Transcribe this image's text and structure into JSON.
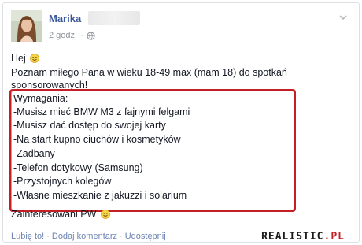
{
  "post": {
    "author": "Marika",
    "time": "2 godz.",
    "privacy_icon": "globe-icon",
    "menu_icon": "chevron-down-icon",
    "greeting": "Hej",
    "greeting_emoji": "smile-icon",
    "intro_line1": "Poznam miłego Pana w wieku 18-49 max (mam 18) do spotkań",
    "intro_line2": "sponsorowanych!",
    "requirements": [
      "Wymagania:",
      "-Musisz mieć BMW M3 z fajnymi felgami",
      "-Musisz dać dostęp do swojej karty",
      "-Na start kupno ciuchów i kosmetyków",
      "-Zadbany",
      "-Telefon dotykowy (Samsung)",
      "-Przystojnych kolegów",
      "-Własne mieszkanie z jakuzzi i solarium"
    ],
    "closing": "Zainteresowani PW",
    "closing_emoji": "smile-icon"
  },
  "actions": {
    "like": "Lubię to!",
    "comment": "Dodaj komentarz",
    "share": "Udostępnij",
    "separator": "·"
  },
  "watermark": {
    "text": "REALISTIC",
    "suffix": ".PL"
  },
  "colors": {
    "highlight": "#c31f25",
    "link": "#3b5998",
    "muted": "#90949c"
  }
}
